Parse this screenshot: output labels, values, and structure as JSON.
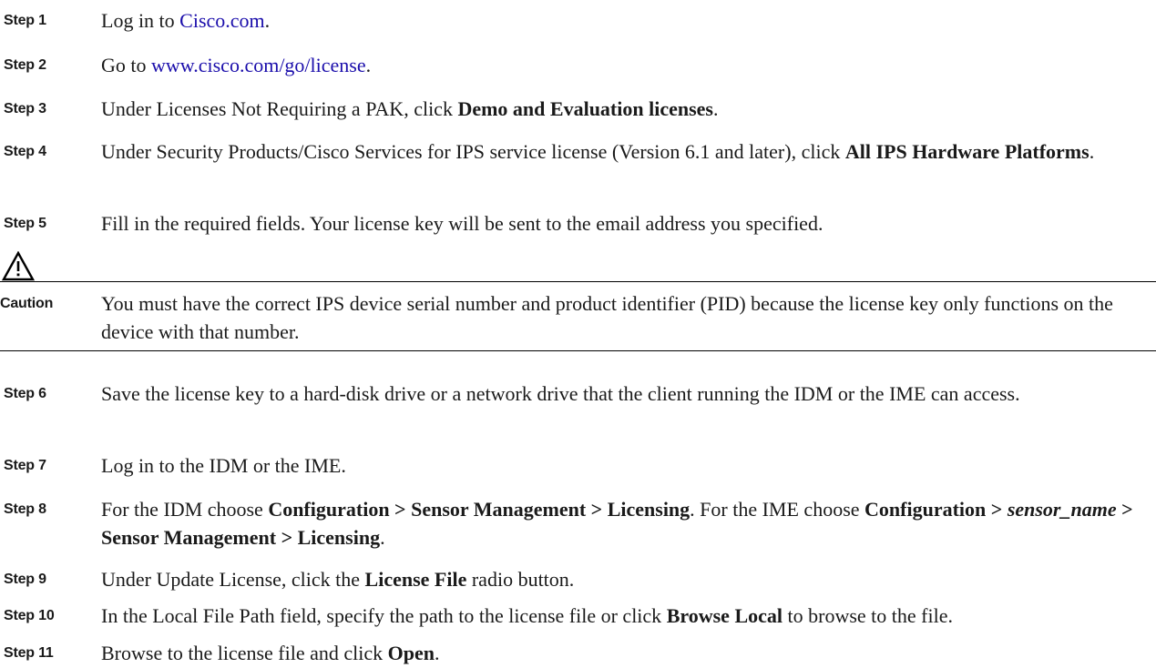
{
  "steps": [
    {
      "label": "Step 1",
      "pre": "Log in to ",
      "link": "Cisco.com",
      "post": "."
    },
    {
      "label": "Step 2",
      "pre": "Go to ",
      "link": "www.cisco.com/go/license",
      "post": "."
    },
    {
      "label": "Step 3",
      "pre": "Under Licenses Not Requiring a PAK, click ",
      "bold": "Demo and Evaluation licenses",
      "post": "."
    },
    {
      "label": "Step 4",
      "pre": "Under Security Products/Cisco Services for IPS service license (Version 6.1 and later), click ",
      "bold": "All IPS Hardware Platforms",
      "post": "."
    },
    {
      "label": "Step 5",
      "text": "Fill in the required fields. Your license key will be sent to the email address you specified."
    },
    {
      "label": "Step 6",
      "text": "Save the license key to a hard-disk drive or a network drive that the client running the IDM or the IME can access."
    },
    {
      "label": "Step 7",
      "text": "Log in to the IDM or the IME."
    },
    {
      "label": "Step 8",
      "pre": "For the IDM choose ",
      "bold1": "Configuration > Sensor Management > Licensing",
      "mid": ". For the IME choose ",
      "bold2a": "Configuration > ",
      "italic": "sensor_name",
      "bold2b": " > Sensor Management > Licensing",
      "post": "."
    },
    {
      "label": "Step 9",
      "pre": "Under Update License, click the ",
      "bold": "License File",
      "post": " radio button."
    },
    {
      "label": "Step 10",
      "pre": "In the Local File Path field, specify the path to the license file or click ",
      "bold": "Browse Local",
      "post": " to browse to the file."
    },
    {
      "label": "Step 11",
      "pre": "Browse to the license file and click ",
      "bold": "Open",
      "post": "."
    }
  ],
  "caution": {
    "label": "Caution",
    "text": "You must have the correct IPS device serial number and product identifier (PID) because the license key only functions on the device with that number."
  },
  "icons": {
    "caution": "warning-triangle-icon"
  }
}
